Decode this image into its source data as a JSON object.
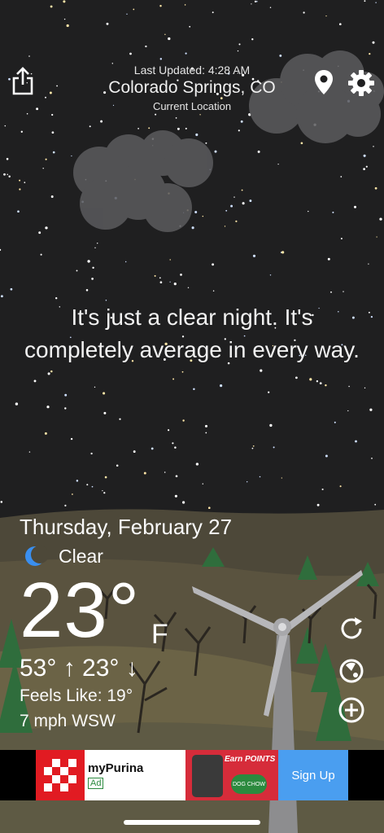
{
  "header": {
    "last_updated": "Last Updated: 4:28 AM",
    "city": "Colorado Springs, CO",
    "location_label": "Current Location"
  },
  "message": "It's just a clear night. It's completely average in every way.",
  "weather": {
    "date": "Thursday, February 27",
    "condition": "Clear",
    "temperature": "23°",
    "unit": "F",
    "high_low": "53° ↑  23° ↓",
    "feels_like": "Feels Like: 19°",
    "wind": "7 mph WSW"
  },
  "actions": {
    "icons": [
      "share-icon",
      "location-pin-icon",
      "gear-icon",
      "refresh-icon",
      "radar-icon",
      "add-icon"
    ]
  },
  "ad": {
    "brand": "myPurina",
    "badge": "Ad",
    "promo_title": "Earn POINTS",
    "promo_product": "DOG CHOW",
    "cta": "Sign Up"
  },
  "colors": {
    "sky": "#1f1f20",
    "ground": "#4f4a3a",
    "purina_red": "#e11b22",
    "cta_blue": "#4a9ef0"
  }
}
